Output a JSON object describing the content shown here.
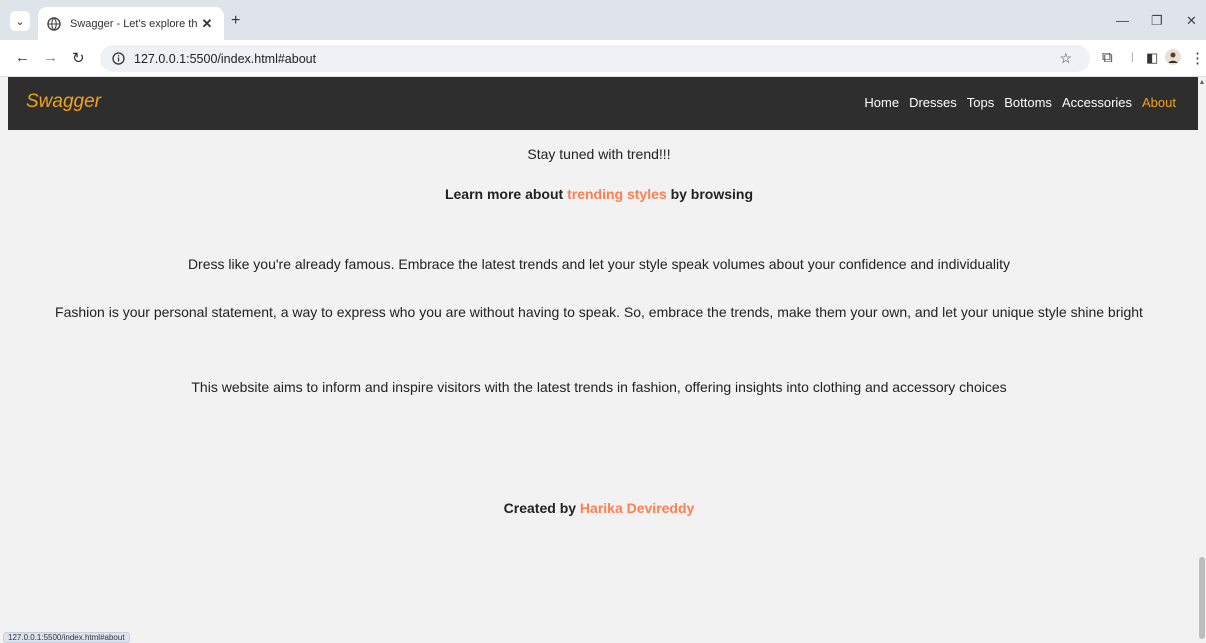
{
  "browser": {
    "tab_title": "Swagger - Let's explore the tren",
    "url": "127.0.0.1:5500/index.html#about",
    "status_url": "127.0.0.1:5500/index.html#about"
  },
  "site": {
    "brand": "Swagger",
    "nav": [
      {
        "label": "Home"
      },
      {
        "label": "Dresses"
      },
      {
        "label": "Tops"
      },
      {
        "label": "Bottoms"
      },
      {
        "label": "Accessories"
      },
      {
        "label": "About",
        "active": true
      }
    ]
  },
  "about": {
    "stay_tuned": "Stay tuned with trend!!!",
    "learn_prefix": "Learn more about ",
    "learn_link": "trending styles",
    "learn_suffix": " by browsing",
    "paragraph_1": "Dress like you're already famous. Embrace the latest trends and let your style speak volumes about your confidence and individuality",
    "paragraph_2": "Fashion is your personal statement, a way to express who you are without having to speak. So, embrace the trends, make them your own, and let your unique style shine bright",
    "paragraph_3": "This website aims to inform and inspire visitors with the latest trends in fashion, offering insights into clothing and accessory choices",
    "created_prefix": "Created by ",
    "created_name": "Harika Devireddy"
  },
  "colors": {
    "accent": "#ff7f50",
    "brand": "#f1a21b",
    "nav_bg": "#2e2e2e"
  }
}
